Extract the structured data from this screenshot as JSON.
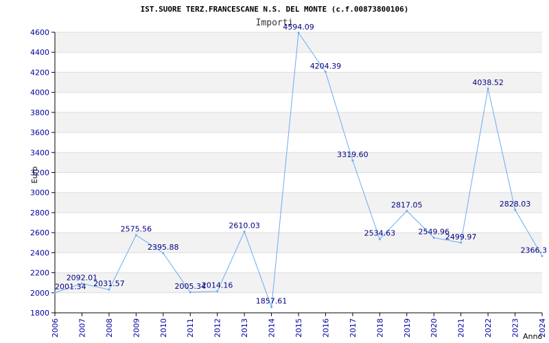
{
  "chart_data": {
    "type": "line",
    "title": "IST.SUORE TERZ.FRANCESCANE N.S. DEL MONTE (c.f.00873800106)",
    "subtitle": "Importi",
    "ylabel": "Euro",
    "xlabel": "Anno",
    "ylim": [
      1800,
      4600
    ],
    "y_ticks": [
      1800,
      2000,
      2200,
      2400,
      2600,
      2800,
      3000,
      3200,
      3400,
      3600,
      3800,
      4000,
      4200,
      4400,
      4600
    ],
    "x": [
      "2006",
      "2007",
      "2008",
      "2009",
      "2010",
      "2011",
      "2012",
      "2013",
      "2014",
      "2015",
      "2016",
      "2017",
      "2018",
      "2019",
      "2020",
      "2021",
      "2022",
      "2023",
      "2024"
    ],
    "series": [
      {
        "values": [
          2001.34,
          2092.01,
          2031.57,
          2575.56,
          2395.88,
          2005.34,
          2014.16,
          2610.03,
          1857.61,
          4594.09,
          4204.39,
          3319.6,
          2534.63,
          2817.05,
          2549.96,
          2499.97,
          4038.52,
          2828.03,
          2366.3
        ],
        "labels": [
          "2001.34",
          "2092.01",
          "2031.57",
          "2575.56",
          "2395.88",
          "2005.34",
          "2014.16",
          "2610.03",
          "1857.61",
          "4594.09",
          "4204.39",
          "3319.60",
          "2534.63",
          "2817.05",
          "2549.96",
          "2499.97",
          "4038.52",
          "2828.03",
          "2366.3"
        ]
      }
    ],
    "grid": true,
    "colors": {
      "line": "#6aaaf0",
      "band": "#f2f2f2",
      "grid": "#dddddd",
      "tick": "#0000a0",
      "data_label": "#000080"
    }
  }
}
